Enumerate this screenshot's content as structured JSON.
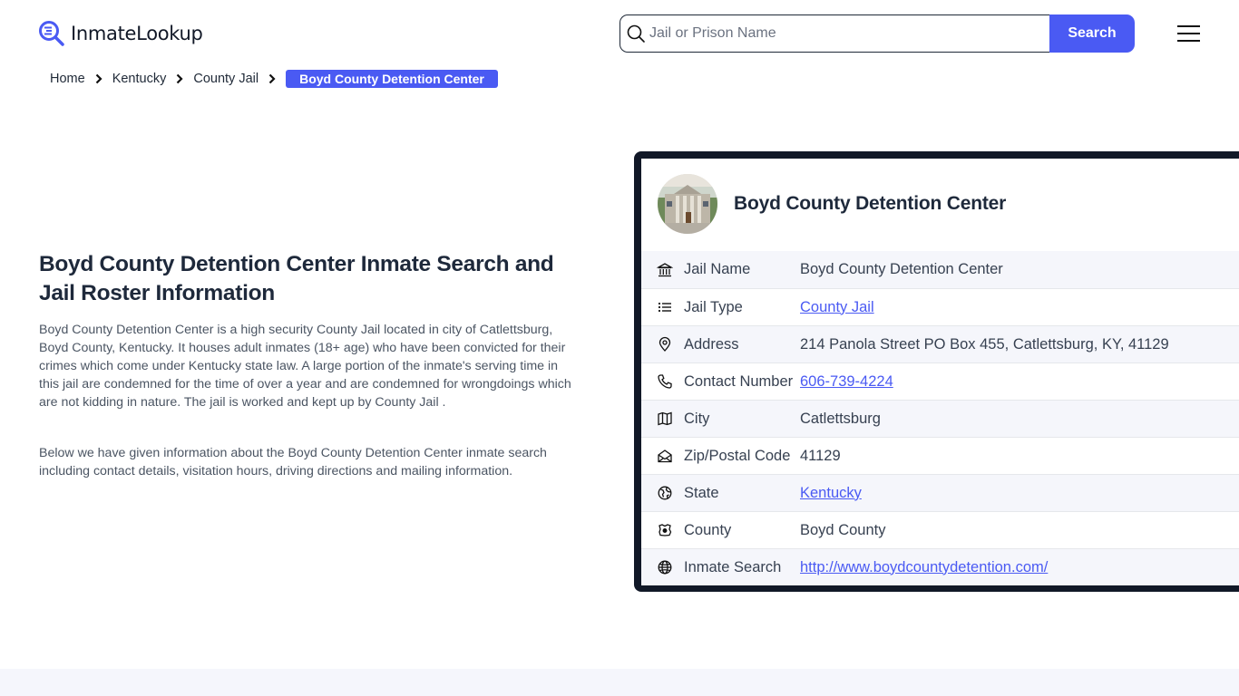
{
  "brand": {
    "name": "InmateLookup",
    "accent_color": "#4a5af3",
    "dark_color": "#111827"
  },
  "header": {
    "search": {
      "placeholder": "Jail or Prison Name",
      "value": "",
      "button_label": "Search"
    },
    "menu_icon": "hamburger-menu-icon"
  },
  "breadcrumb": {
    "items": [
      {
        "label": "Home"
      },
      {
        "label": "Kentucky"
      },
      {
        "label": "County Jail"
      }
    ],
    "current": "Boyd County Detention Center"
  },
  "main": {
    "title": "Boyd County Detention Center Inmate Search and Jail Roster Information",
    "paragraphs": [
      "Boyd County Detention Center is a high security County Jail located in city of Catlettsburg, Boyd County, Kentucky. It houses adult inmates (18+ age) who have been convicted for their crimes which come under Kentucky state law. A large portion of the inmate's serving time in this jail are condemned for the time of over a year and are condemned for wrongdoings which are not kidding in nature. The jail is worked and kept up by County Jail .",
      "Below we have given information about the Boyd County Detention Center inmate search including contact details, visitation hours, driving directions and mailing information."
    ]
  },
  "card": {
    "title": "Boyd County Detention Center",
    "rows": [
      {
        "icon": "building-columns-icon",
        "label": "Jail Name",
        "value": "Boyd County Detention Center",
        "link": false
      },
      {
        "icon": "list-icon",
        "label": "Jail Type",
        "value": "County Jail",
        "link": true
      },
      {
        "icon": "map-pin-icon",
        "label": "Address",
        "value": "214 Panola Street PO Box 455, Catlettsburg, KY, 41129",
        "link": false
      },
      {
        "icon": "phone-icon",
        "label": "Contact Number",
        "value": "606-739-4224",
        "link": true
      },
      {
        "icon": "map-icon",
        "label": "City",
        "value": "Catlettsburg",
        "link": false
      },
      {
        "icon": "mail-open-icon",
        "label": "Zip/Postal Code",
        "value": "41129",
        "link": false
      },
      {
        "icon": "globe-region-icon",
        "label": "State",
        "value": "Kentucky",
        "link": true
      },
      {
        "icon": "county-map-icon",
        "label": "County",
        "value": "Boyd County",
        "link": false
      },
      {
        "icon": "world-icon",
        "label": "Inmate Search",
        "value": "http://www.boydcountydetention.com/",
        "link": true
      }
    ]
  }
}
